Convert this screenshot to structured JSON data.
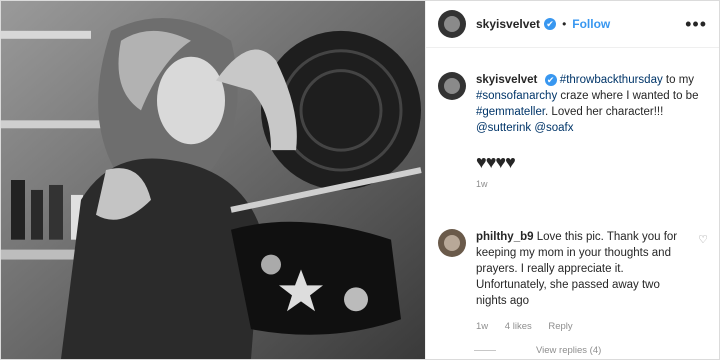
{
  "header": {
    "username": "skyisvelvet",
    "verified_glyph": "✔",
    "dot": "•",
    "follow_label": "Follow",
    "more_glyph": "•••"
  },
  "caption": {
    "username": "skyisvelvet",
    "verified_glyph": "✔",
    "hashtag1": "#throwbackthursday",
    "text1": " to my ",
    "hashtag2": "#sonsofanarchy",
    "text2": " craze where I wanted to be ",
    "hashtag3": "#gemmateller",
    "text3": ". Loved her character!!!",
    "mention1": "@sutterink",
    "mention2": "@soafx",
    "hearts": "♥♥♥♥",
    "timestamp": "1w"
  },
  "comment": {
    "username": "philthy_b9",
    "text": "Love this pic. Thank you for keeping my mom in your thoughts and prayers. I really appreciate it. Unfortunately, she passed away two nights ago",
    "time": "1w",
    "likes": "4 likes",
    "reply_label": "Reply",
    "like_icon": "heart-outline-icon",
    "like_glyph": "♡"
  },
  "view_replies": "View replies (4)"
}
